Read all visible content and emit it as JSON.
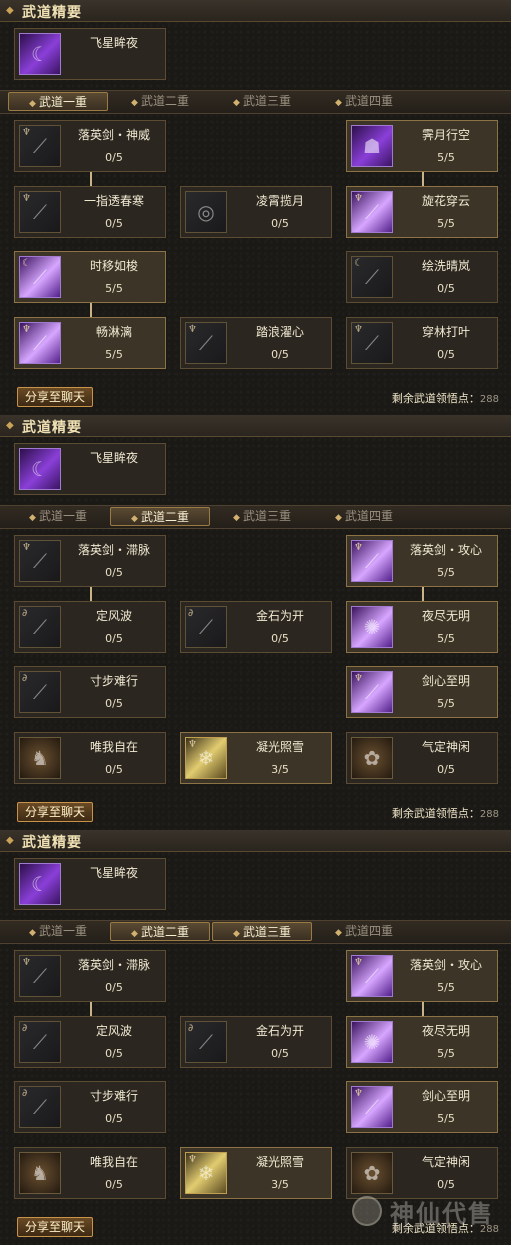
{
  "colors": {
    "accent": "#c9a458",
    "text": "#efe6c8",
    "panel_bg": "#2b2620"
  },
  "panels": [
    {
      "header": "武道精要",
      "zhi": {
        "name": "飞星眸夜",
        "icon": "moon-shadow-icon"
      },
      "tabs": [
        {
          "label": "武道一重",
          "active": true
        },
        {
          "label": "武道二重",
          "active": false
        },
        {
          "label": "武道三重",
          "active": false
        },
        {
          "label": "武道四重",
          "active": false
        }
      ],
      "skills": [
        {
          "name": "落英剑・神威",
          "level": "0/5",
          "icon": "sword-slash-icon"
        },
        {
          "name": "霁月行空",
          "level": "5/5",
          "icon": "shadow-figure-icon"
        },
        {
          "name": "一指透春寒",
          "level": "0/5",
          "icon": "finger-strike-icon"
        },
        {
          "name": "凌霄揽月",
          "level": "0/5",
          "icon": "moon-gaze-icon"
        },
        {
          "name": "旋花穿云",
          "level": "5/5",
          "icon": "spinning-blade-icon"
        },
        {
          "name": "时移如梭",
          "level": "5/5",
          "icon": "time-shift-icon"
        },
        {
          "name": "绘洗晴岚",
          "level": "0/5",
          "icon": "wash-icon"
        },
        {
          "name": "畅淋漓",
          "level": "5/5",
          "icon": "flow-strike-icon"
        },
        {
          "name": "踏浪濯心",
          "level": "0/5",
          "icon": "wave-step-icon"
        },
        {
          "name": "穿林打叶",
          "level": "0/5",
          "icon": "leaf-strike-icon"
        }
      ],
      "share": "分享至聊天",
      "remain_label": "剩余武道领悟点：",
      "remain_value": "288"
    },
    {
      "header": "武道精要",
      "zhi": {
        "name": "飞星眸夜",
        "icon": "moon-shadow-icon"
      },
      "tabs": [
        {
          "label": "武道一重",
          "active": false
        },
        {
          "label": "武道二重",
          "active": true
        },
        {
          "label": "武道三重",
          "active": false
        },
        {
          "label": "武道四重",
          "active": false
        }
      ],
      "skills": [
        {
          "name": "落英剑・滞脉",
          "level": "0/5",
          "icon": "sword-slash-icon"
        },
        {
          "name": "落英剑・攻心",
          "level": "5/5",
          "icon": "sword-slash-icon"
        },
        {
          "name": "定风波",
          "level": "0/5",
          "icon": "wind-icon"
        },
        {
          "name": "金石为开",
          "level": "0/5",
          "icon": "stone-icon"
        },
        {
          "name": "夜尽无明",
          "level": "5/5",
          "icon": "night-burst-icon"
        },
        {
          "name": "寸步难行",
          "level": "0/5",
          "icon": "slow-step-icon"
        },
        {
          "name": "剑心至明",
          "level": "5/5",
          "icon": "sword-heart-icon"
        },
        {
          "name": "唯我自在",
          "level": "0/5",
          "icon": "demon-figure-icon"
        },
        {
          "name": "凝光照雪",
          "level": "3/5",
          "icon": "light-snow-icon"
        },
        {
          "name": "气定神闲",
          "level": "0/5",
          "icon": "calm-spirit-icon"
        }
      ],
      "share": "分享至聊天",
      "remain_label": "剩余武道领悟点：",
      "remain_value": "288"
    },
    {
      "header": "武道精要",
      "zhi": {
        "name": "飞星眸夜",
        "icon": "moon-shadow-icon"
      },
      "tabs": [
        {
          "label": "武道一重",
          "active": false
        },
        {
          "label": "武道二重",
          "active": true
        },
        {
          "label": "武道三重",
          "active": true
        },
        {
          "label": "武道四重",
          "active": false
        }
      ],
      "skills": [
        {
          "name": "落英剑・滞脉",
          "level": "0/5",
          "icon": "sword-slash-icon"
        },
        {
          "name": "落英剑・攻心",
          "level": "5/5",
          "icon": "sword-slash-icon"
        },
        {
          "name": "定风波",
          "level": "0/5",
          "icon": "wind-icon"
        },
        {
          "name": "金石为开",
          "level": "0/5",
          "icon": "stone-icon"
        },
        {
          "name": "夜尽无明",
          "level": "5/5",
          "icon": "night-burst-icon"
        },
        {
          "name": "寸步难行",
          "level": "0/5",
          "icon": "slow-step-icon"
        },
        {
          "name": "剑心至明",
          "level": "5/5",
          "icon": "sword-heart-icon"
        },
        {
          "name": "唯我自在",
          "level": "0/5",
          "icon": "demon-figure-icon"
        },
        {
          "name": "凝光照雪",
          "level": "3/5",
          "icon": "light-snow-icon"
        },
        {
          "name": "气定神闲",
          "level": "0/5",
          "icon": "calm-spirit-icon"
        }
      ],
      "share": "分享至聊天",
      "remain_label": "剩余武道领悟点：",
      "remain_value": "288"
    }
  ],
  "watermark": {
    "text": "神仙代售",
    "icon": "watermark-logo-icon"
  }
}
